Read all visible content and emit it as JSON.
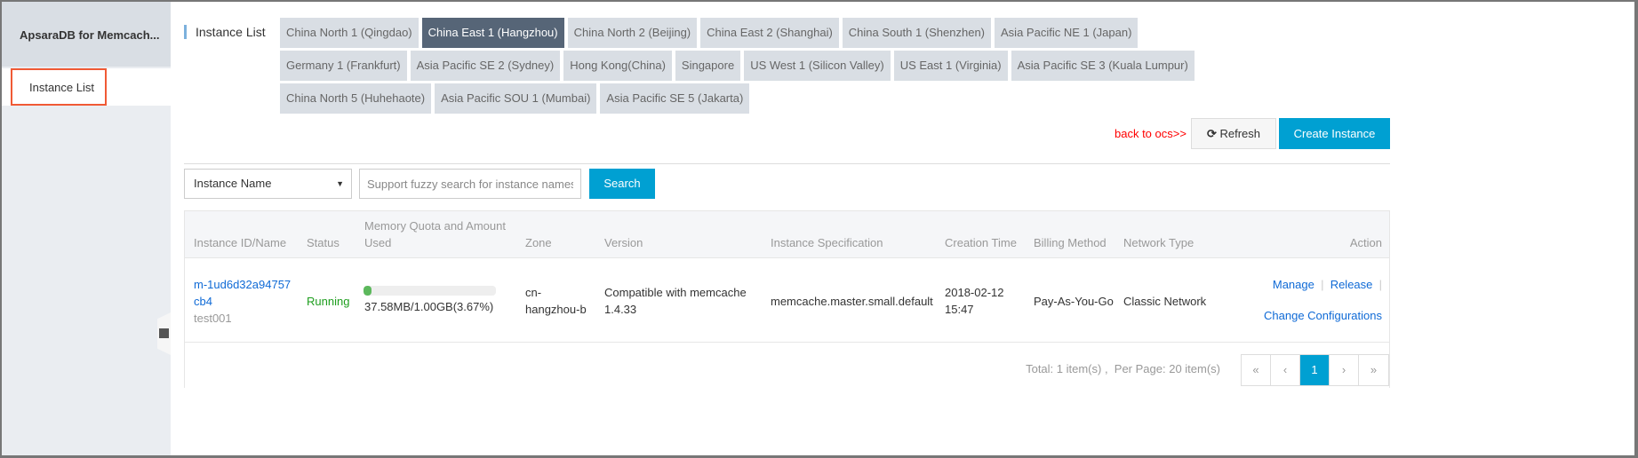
{
  "sidebar": {
    "title": "ApsaraDB for Memcach...",
    "items": [
      {
        "label": "Instance List"
      }
    ]
  },
  "main": {
    "title": "Instance List",
    "regions": [
      "China North 1 (Qingdao)",
      "China East 1 (Hangzhou)",
      "China North 2 (Beijing)",
      "China East 2 (Shanghai)",
      "China South 1 (Shenzhen)",
      "Asia Pacific NE 1 (Japan)",
      "Germany 1 (Frankfurt)",
      "Asia Pacific SE 2 (Sydney)",
      "Hong Kong(China)",
      "Singapore",
      "US West 1 (Silicon Valley)",
      "US East 1 (Virginia)",
      "Asia Pacific SE 3 (Kuala Lumpur)",
      "China North 5 (Huhehaote)",
      "Asia Pacific SOU 1 (Mumbai)",
      "Asia Pacific SE 5 (Jakarta)"
    ],
    "active_region": "China East 1 (Hangzhou)",
    "back_link": "back to ocs>>",
    "refresh_label": "Refresh",
    "create_label": "Create Instance"
  },
  "search": {
    "field": "Instance Name",
    "placeholder": "Support fuzzy search for instance names",
    "button": "Search"
  },
  "table": {
    "headers": [
      "Instance ID/Name",
      "Status",
      "Memory Quota and Amount Used",
      "Zone",
      "Version",
      "Instance Specification",
      "Creation Time",
      "Billing Method",
      "Network Type",
      "Action"
    ],
    "rows": [
      {
        "id": "m-1ud6d32a94757cb4",
        "name": "test001",
        "status": "Running",
        "memory": "37.58MB/1.00GB(3.67%)",
        "memory_pct": 3.67,
        "zone": "cn-hangzhou-b",
        "version": "Compatible with memcache 1.4.33",
        "spec": "memcache.master.small.default",
        "created": "2018-02-12 15:47",
        "billing": "Pay-As-You-Go",
        "network": "Classic Network",
        "actions": [
          "Manage",
          "Release",
          "Change Configurations"
        ]
      }
    ]
  },
  "pager": {
    "total": "Total: 1 item(s) ,  Per Page: 20 item(s)",
    "first": "«",
    "prev": "‹",
    "current": "1",
    "next": "›",
    "last": "»"
  },
  "colors": {
    "accent": "#00a0d2",
    "running": "#1e9e1e",
    "link": "#0f6ad6",
    "back": "#ff0000"
  }
}
